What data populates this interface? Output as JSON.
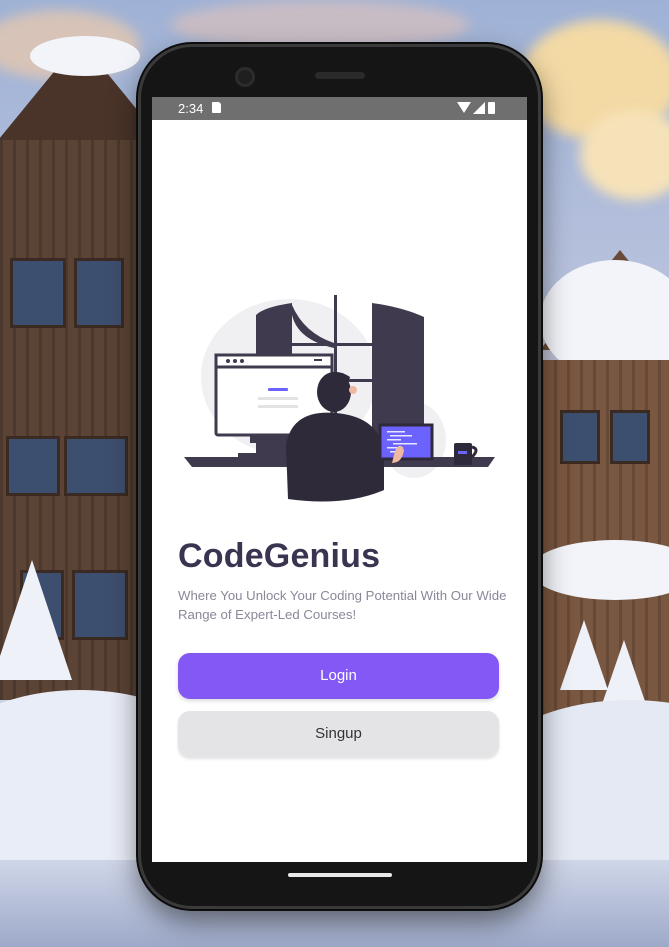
{
  "status_bar": {
    "time": "2:34"
  },
  "app": {
    "title": "CodeGenius",
    "subtitle": "Where You Unlock Your Coding Potential With Our Wide Range of Expert-Led Courses!",
    "login_label": "Login",
    "signup_label": "Singup"
  },
  "colors": {
    "primary": "#8358f5",
    "secondary_button": "#e4e4e6",
    "title": "#3b3450",
    "subtitle": "#8b8799"
  },
  "illustration": {
    "name": "developer-at-desk-illustration"
  },
  "icons": [
    "sd-card-icon",
    "wifi-icon",
    "signal-icon",
    "battery-icon"
  ]
}
